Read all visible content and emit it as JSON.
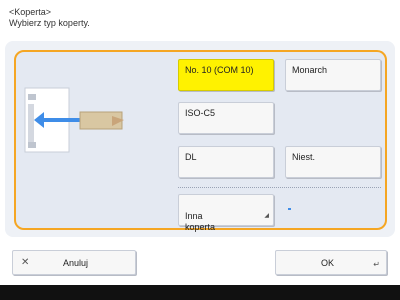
{
  "header": {
    "title": "<Koperta>",
    "subtitle": "Wybierz typ koperty."
  },
  "options": {
    "no10": "No. 10 (COM 10)",
    "monarch": "Monarch",
    "iso_c5": "ISO-C5",
    "dl": "DL",
    "nagaga": "Niest.",
    "other": "Inna\nkoperta"
  },
  "selected_option": "No. 10 (COM 10)",
  "footer": {
    "cancel": "Anuluj",
    "ok": "OK"
  },
  "colors": {
    "accent": "#f5a623",
    "selected": "#fff200",
    "panel": "#e4e9f2"
  }
}
